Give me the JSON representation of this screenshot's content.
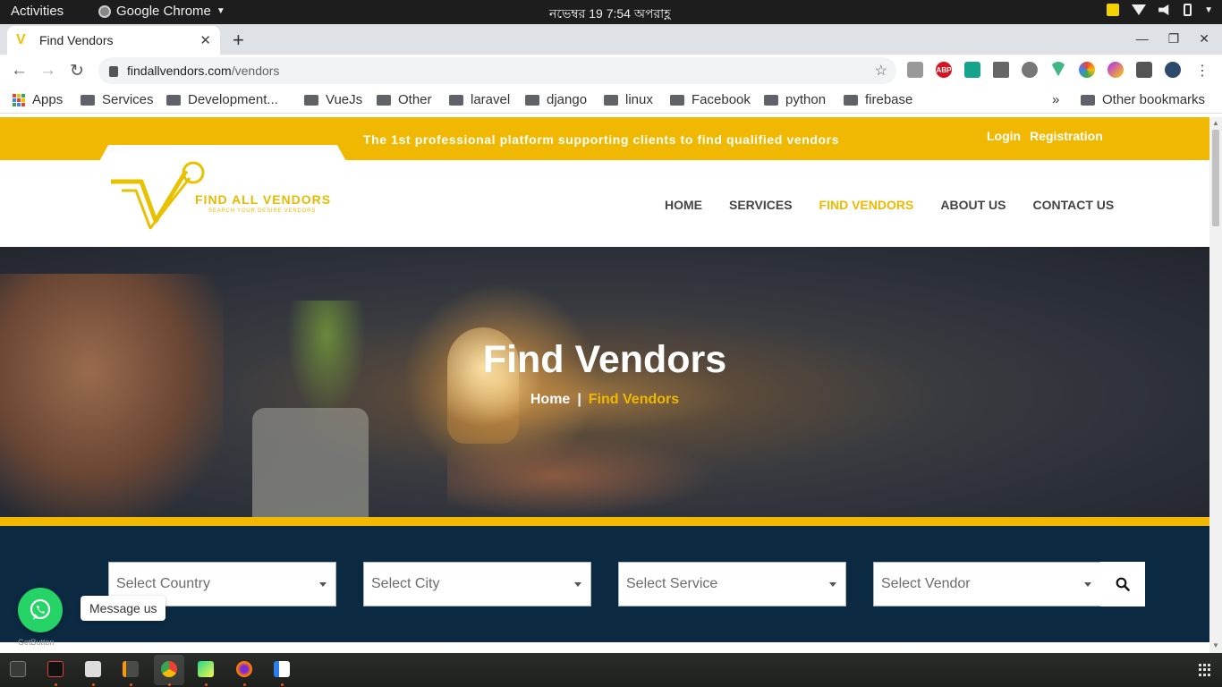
{
  "topbar": {
    "activities": "Activities",
    "app_name": "Google Chrome",
    "clock": "নভেম্বর 19   7:54 অপরাহ্ণ"
  },
  "browser": {
    "tab_title": "Find Vendors",
    "url_host": "findallvendors.com",
    "url_path": "/vendors"
  },
  "bookmarks": {
    "apps": "Apps",
    "folders": [
      "Services",
      "Development...",
      "VueJs",
      "Other",
      "laravel",
      "django",
      "linux",
      "Facebook",
      "python",
      "firebase"
    ],
    "overflow": "»",
    "other": "Other bookmarks"
  },
  "site": {
    "tagline": "The 1st professional platform supporting clients to find qualified vendors",
    "login": "Login",
    "registration": "Registration",
    "logo_text": "FIND ALL VENDORS",
    "logo_sub": "SEARCH YOUR DESIRE VENDORS",
    "nav": [
      "HOME",
      "SERVICES",
      "FIND VENDORS",
      "ABOUT US",
      "CONTACT US"
    ],
    "active_nav": "FIND VENDORS",
    "accent_color": "#f0b800",
    "filter_bg": "#0b2a42"
  },
  "hero": {
    "title": "Find Vendors",
    "crumb_home": "Home",
    "crumb_sep": "|",
    "crumb_current": "Find Vendors"
  },
  "filters": {
    "country": "Select Country",
    "city": "Select City",
    "service": "Select Service",
    "vendor": "Select Vendor"
  },
  "whatsapp": {
    "message": "Message us",
    "caption": "GetButton"
  }
}
